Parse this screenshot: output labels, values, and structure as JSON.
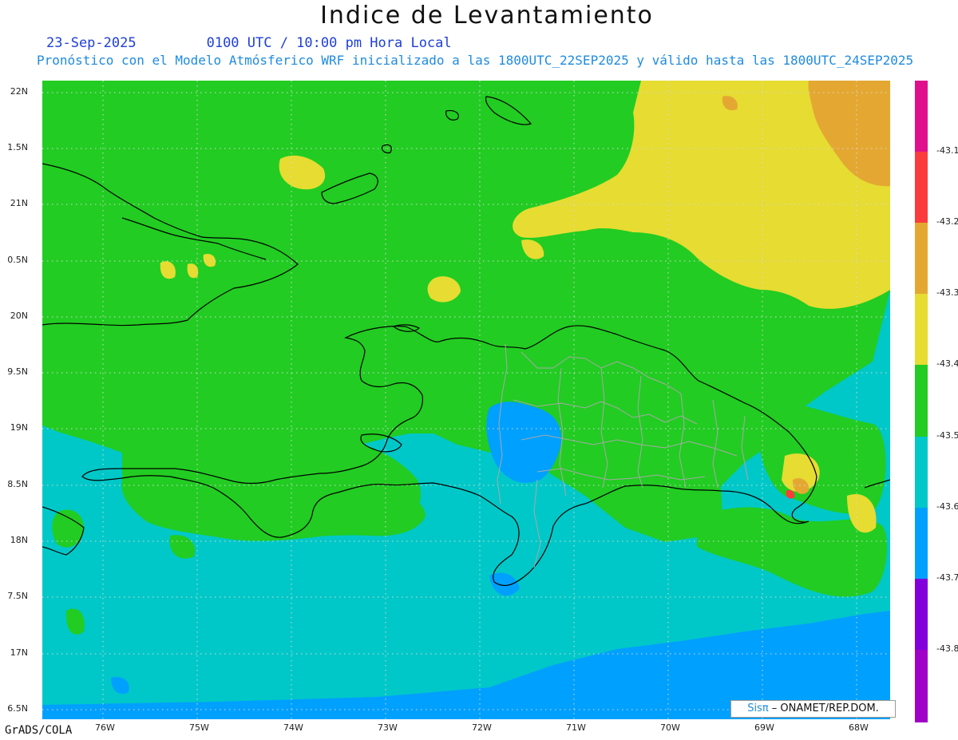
{
  "title": "Indice de Levantamiento",
  "date": "23-Sep-2025",
  "time": "0100 UTC / 10:00 pm Hora Local",
  "model_info": "Pronóstico con el Modelo Atmósferico WRF inicializado a las 1800UTC_22SEP2025 y válido hasta las  1800UTC_24SEP2025",
  "footer": "GrADS/COLA",
  "credit": {
    "logo": "Sisπ",
    "text": " – ONAMET/REP.DOM."
  },
  "lat_labels": [
    "22N",
    "1.5N",
    "21N",
    "0.5N",
    "20N",
    "9.5N",
    "19N",
    "8.5N",
    "18N",
    "7.5N",
    "17N",
    "6.5N"
  ],
  "lon_labels": [
    "76W",
    "75W",
    "74W",
    "73W",
    "72W",
    "71W",
    "70W",
    "69W",
    "68W"
  ],
  "colorbar": {
    "colors": [
      "#e0108c",
      "#fa3c3c",
      "#e4a832",
      "#e6dc32",
      "#22cc22",
      "#00c8c8",
      "#00a0ff",
      "#8200dc",
      "#a000c8"
    ],
    "labels": [
      "-43.1",
      "-43.2",
      "-43.3",
      "-43.4",
      "-43.5",
      "-43.6",
      "-43.7",
      "-43.8"
    ]
  },
  "colors": {
    "ocean": "#00c8c8",
    "green": "#22cc22",
    "yellow": "#e6dc32",
    "orange": "#e4a832",
    "blue": "#00a0ff",
    "red": "#fa3c3c"
  }
}
